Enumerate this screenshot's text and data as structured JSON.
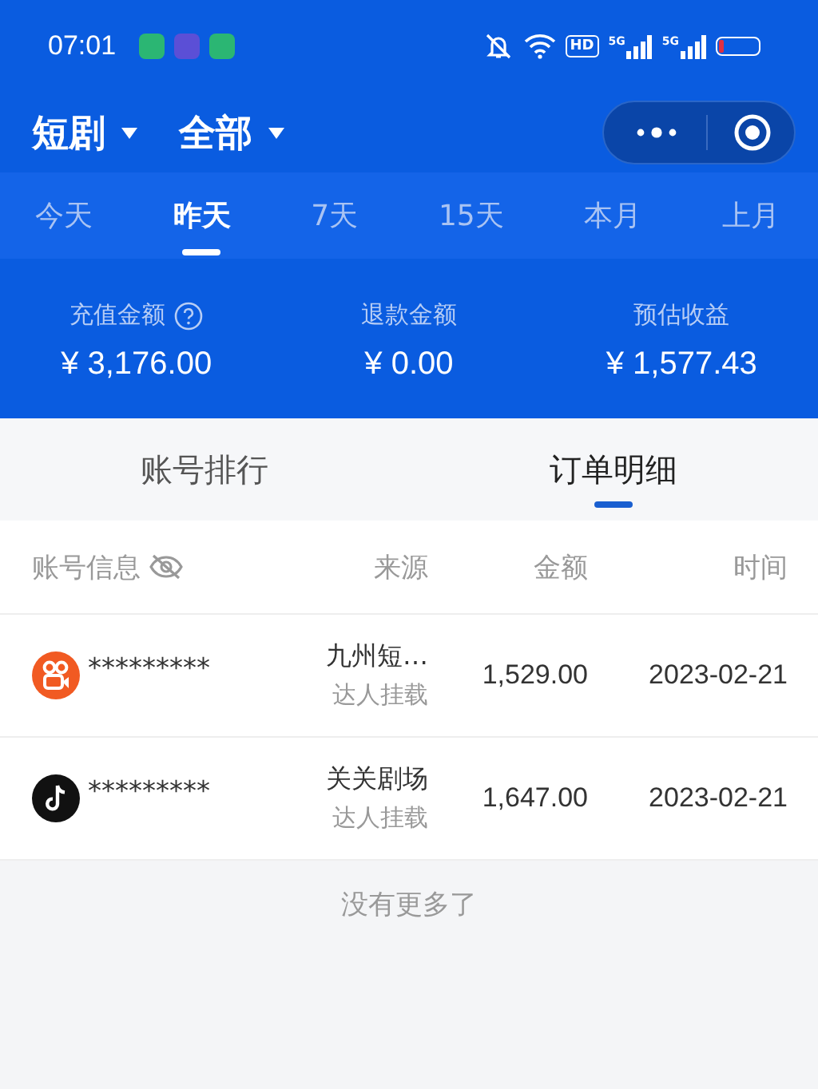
{
  "status_bar": {
    "time": "07:01",
    "notifications": [
      {
        "color": "#2bb673"
      },
      {
        "color": "#5b4fd6"
      },
      {
        "color": "#2bb673"
      }
    ],
    "hd_label": "HD",
    "network_labels": [
      "5G",
      "5G"
    ]
  },
  "header": {
    "filters": [
      {
        "label": "短剧"
      },
      {
        "label": "全部"
      }
    ]
  },
  "period_tabs": [
    {
      "label": "今天",
      "selected": false
    },
    {
      "label": "昨天",
      "selected": true
    },
    {
      "label": "7天",
      "selected": false
    },
    {
      "label": "15天",
      "selected": false
    },
    {
      "label": "本月",
      "selected": false
    },
    {
      "label": "上月",
      "selected": false
    }
  ],
  "summary": [
    {
      "label": "充值金额",
      "help": true,
      "value": "¥ 3,176.00"
    },
    {
      "label": "退款金额",
      "help": false,
      "value": "¥ 0.00"
    },
    {
      "label": "预估收益",
      "help": false,
      "value": "¥ 1,577.43"
    }
  ],
  "section_tabs": [
    {
      "label": "账号排行",
      "selected": false
    },
    {
      "label": "订单明细",
      "selected": true
    }
  ],
  "table": {
    "columns": [
      "账号信息",
      "来源",
      "金额",
      "时间"
    ],
    "rows": [
      {
        "platform": {
          "kind": "kuaishou"
        },
        "account": "*********",
        "source": "九州短…",
        "source_type": "达人挂载",
        "amount": "1,529.00",
        "date": "2023-02-21"
      },
      {
        "platform": {
          "kind": "douyin"
        },
        "account": "*********",
        "source": "关关剧场",
        "source_type": "达人挂载",
        "amount": "1,647.00",
        "date": "2023-02-21"
      }
    ]
  },
  "footer": "没有更多了"
}
